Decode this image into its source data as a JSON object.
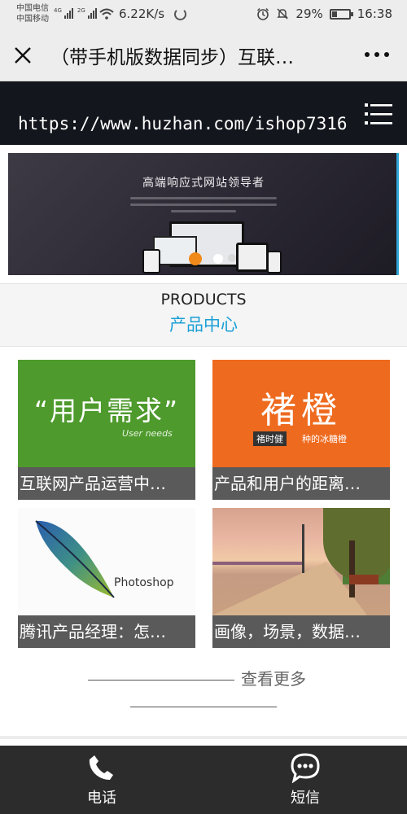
{
  "status_bar": {
    "carrier_1": "中国电信",
    "carrier_2": "中国移动",
    "net_1": "4G",
    "net_2": "2G",
    "speed": "6.22K/s",
    "battery_percent": "29%",
    "battery_level": 0.29,
    "time": "16:38"
  },
  "top_nav": {
    "title": "（带手机版数据同步）互联…"
  },
  "site_header": {
    "url": "https://www.huzhan.com/ishop7316"
  },
  "banner": {
    "title": "高端响应式网站领导者"
  },
  "products": {
    "heading_en": "PRODUCTS",
    "heading_cn": "产品中心",
    "items": [
      {
        "caption": "互联网产品运营中…",
        "thumb_text": "“用户需求”",
        "thumb_subtext": "User needs"
      },
      {
        "caption": "产品和用户的距离…",
        "thumb_text": "褚橙",
        "thumb_tag": "褚时健",
        "thumb_subtext": "种的冰糖橙"
      },
      {
        "caption": "腾讯产品经理：怎…",
        "thumb_text": "Photoshop"
      },
      {
        "caption": "画像，场景，数据…"
      }
    ],
    "more_label": "查看更多"
  },
  "bottom_bar": {
    "call_label": "电话",
    "sms_label": "短信"
  },
  "colors": {
    "accent": "#1a9fd6",
    "header_bg": "#13161d",
    "bottom_bar_bg": "#2c2c2c",
    "caption_bg": "#5a5a5a"
  }
}
